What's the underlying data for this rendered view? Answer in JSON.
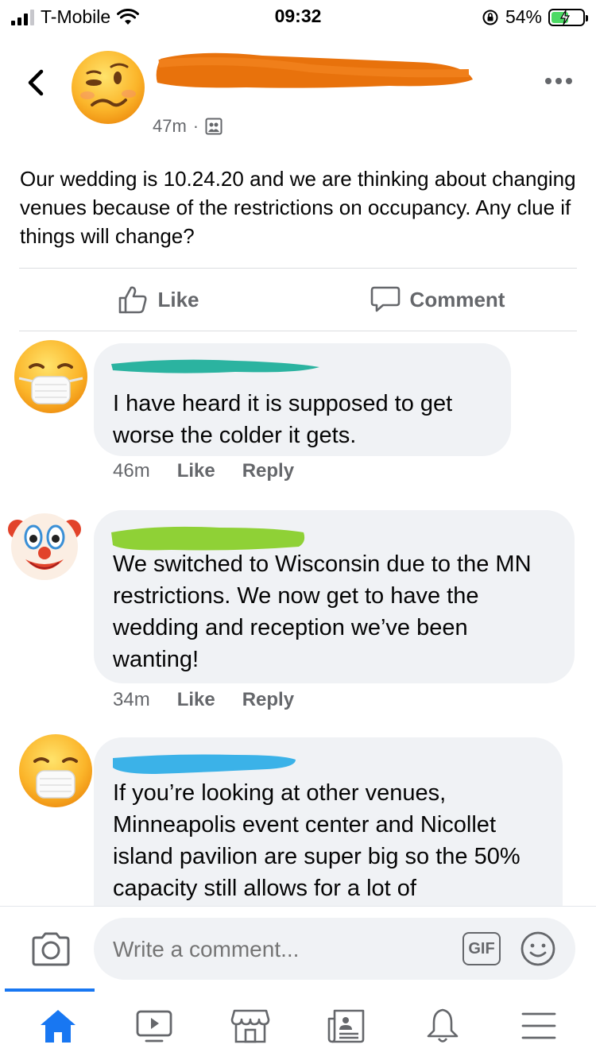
{
  "status_bar": {
    "carrier": "T-Mobile",
    "time": "09:32",
    "battery": "54%",
    "battery_level": 0.54
  },
  "post": {
    "time": "47m",
    "separator": "·",
    "text": "Our wedding is 10.24.20 and we are thinking about changing venues because of the restrictions on occupancy. Any clue if things will change?",
    "author_redaction_color": "#e8720c"
  },
  "actions": {
    "like": "Like",
    "comment": "Comment"
  },
  "comments": [
    {
      "text": "I have heard it is supposed to get worse the colder it gets.",
      "time": "46m",
      "like": "Like",
      "reply": "Reply",
      "avatar": "mask-face-emoji",
      "redaction_color": "#2bb3a0"
    },
    {
      "text": "We switched to Wisconsin due to the MN restrictions. We now get to have the wedding and reception we’ve been wanting!",
      "time": "34m",
      "like": "Like",
      "reply": "Reply",
      "avatar": "clown-face-emoji",
      "redaction_color": "#8fd136"
    },
    {
      "text": "If you’re looking at other venues, Minneapolis event center and Nicollet island pavilion are super big so the 50% capacity still allows for a lot of",
      "avatar": "mask-face-emoji",
      "redaction_color": "#3bb2e8"
    }
  ],
  "composer": {
    "placeholder": "Write a comment...",
    "gif": "GIF"
  },
  "tabs": [
    "home-icon",
    "watch-icon",
    "marketplace-icon",
    "news-icon",
    "notifications-icon",
    "menu-icon"
  ],
  "colors": {
    "accent": "#1877f2",
    "secondary_text": "#65676b",
    "bubble": "#f0f2f5"
  }
}
